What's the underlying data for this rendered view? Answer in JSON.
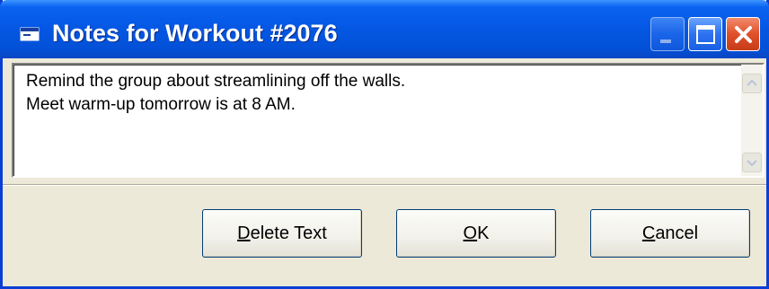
{
  "window": {
    "title": "Notes for Workout #2076",
    "controls": {
      "minimize_icon": "minimize-icon",
      "maximize_icon": "maximize-icon",
      "close_icon": "close-icon"
    },
    "colors": {
      "titlebar": "#0457e3",
      "frame": "#0b3fd4",
      "close": "#e0502a",
      "body": "#ece9d8"
    }
  },
  "notes": {
    "text": "Remind the group about streamlining off the walls.\nMeet warm-up tomorrow is at 8 AM."
  },
  "buttons": {
    "delete": {
      "accel": "D",
      "rest": "elete Text"
    },
    "ok": {
      "accel": "O",
      "rest": "K"
    },
    "cancel": {
      "accel": "C",
      "rest": "ancel"
    }
  }
}
